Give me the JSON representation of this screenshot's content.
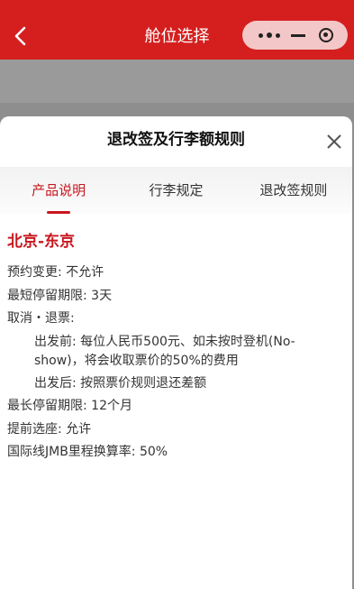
{
  "topbar": {
    "title": "舱位选择",
    "back_icon": "chevron-left-icon",
    "color": "#d51f1f"
  },
  "sheet": {
    "title": "退改签及行李额规则",
    "tabs": [
      {
        "label": "产品说明",
        "active": true
      },
      {
        "label": "行李规定",
        "active": false
      },
      {
        "label": "退改签规则",
        "active": false
      }
    ],
    "accent": "#c8161e"
  },
  "rules": {
    "route": "北京-东京",
    "reservation_change": "预约变更: 不允许",
    "min_stay": "最短停留期限: 3天",
    "cancel_refund_title": "取消・退票:",
    "before_departure": "出发前: 每位人民币500元、如未按时登机(No-show)，将会收取票价的50%的费用",
    "after_departure": "出发后: 按照票价规则退还差额",
    "max_stay": "最长停留期限: 12个月",
    "seat_selection": "提前选座: 允许",
    "jmb_rate": "国际线JMB里程换算率: 50%"
  }
}
